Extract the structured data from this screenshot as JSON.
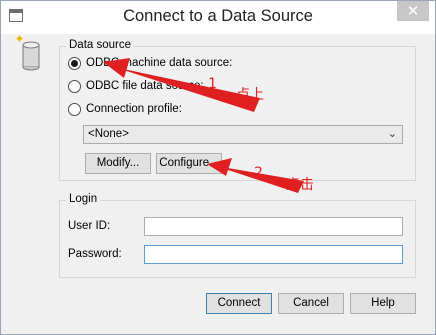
{
  "window": {
    "title": "Connect to a Data Source",
    "close_glyph": "✕"
  },
  "data_source": {
    "legend": "Data source",
    "options": [
      {
        "label": "ODBC machine data source:",
        "selected": true
      },
      {
        "label": "ODBC file data source:",
        "selected": false
      },
      {
        "label": "Connection profile:",
        "selected": false
      }
    ],
    "select_value": "<None>",
    "modify_label": "Modify...",
    "configure_label": "Configure..."
  },
  "login": {
    "legend": "Login",
    "user_id_label": "User ID:",
    "user_id_value": "",
    "password_label": "Password:",
    "password_value": ""
  },
  "buttons": {
    "connect": "Connect",
    "cancel": "Cancel",
    "help": "Help"
  },
  "annotations": {
    "note1_number": "1",
    "note1_text": "点上",
    "note2_number": "2",
    "note2_text": "点击",
    "color": "#e02020"
  }
}
